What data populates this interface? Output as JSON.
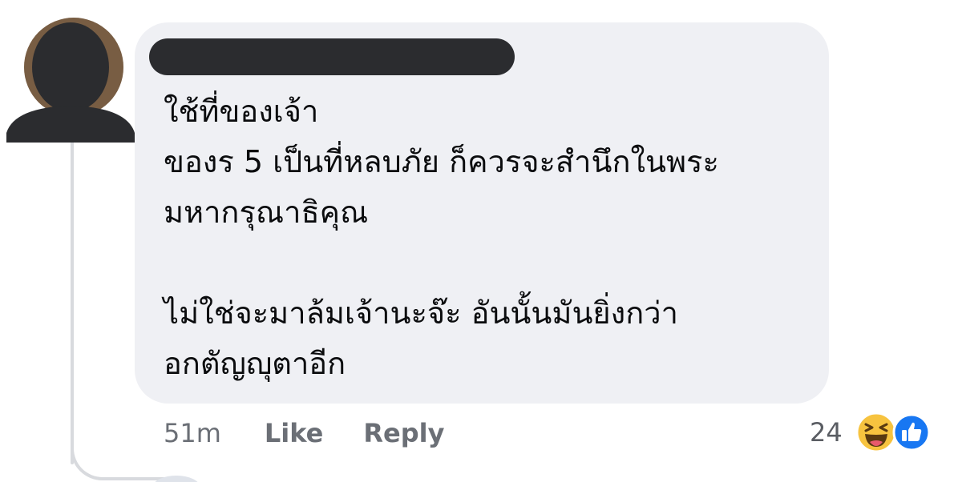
{
  "comment": {
    "author_name": "",
    "text": "ใช้ที่ของเจ้า\nของร 5 เป็นที่หลบภัย ก็ควรจะสำนึกในพระ\nมหากรุณาธิคุณ\n\nไม่ใช่จะมาล้มเจ้านะจ๊ะ อันนั้นมันยิ่งกว่า\nอกตัญญุตาอีก",
    "time": "51m",
    "actions": {
      "like_label": "Like",
      "reply_label": "Reply"
    },
    "reactions": {
      "count": "24",
      "types": [
        "haha-icon",
        "like-icon"
      ]
    }
  },
  "colors": {
    "bubble_bg": "#eff0f4",
    "avatar_silhouette": "#2b2c2f",
    "meta_text": "#6b6f76",
    "like_blue": "#1877f2",
    "haha_yellow": "#f7c33f"
  }
}
